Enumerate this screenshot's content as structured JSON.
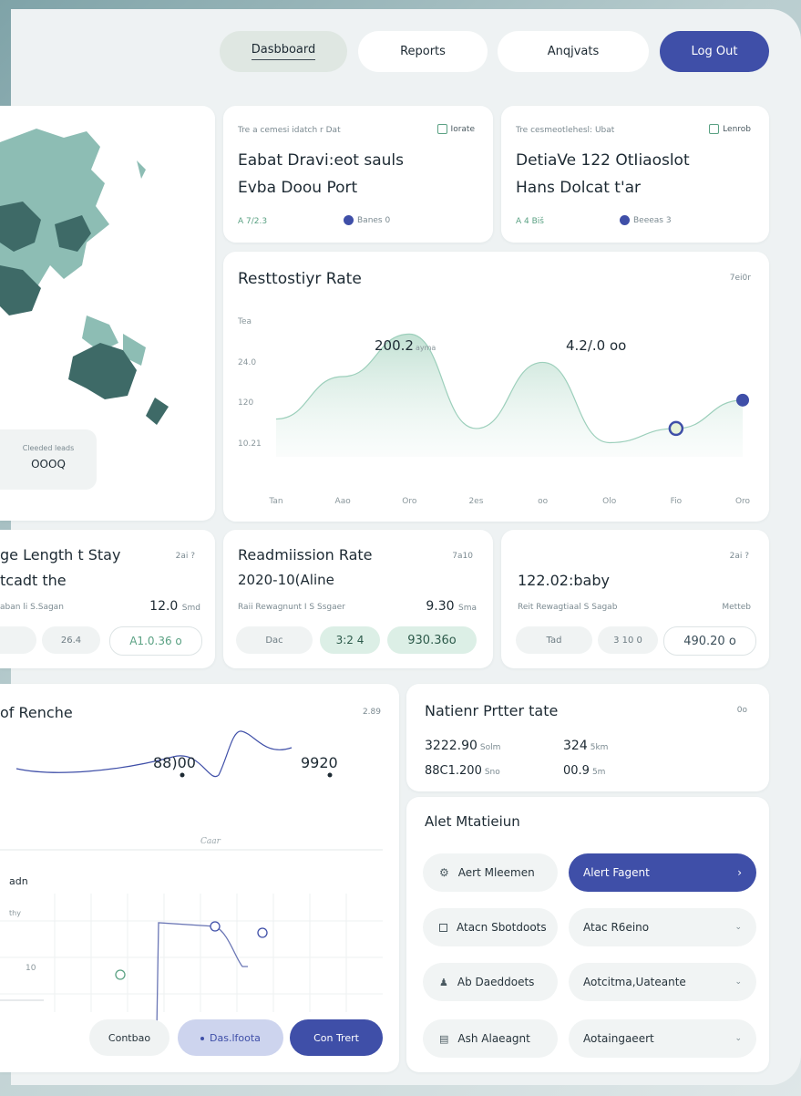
{
  "nav": {
    "dashboard": "Dasbboard",
    "reports": "Reports",
    "analytics": "Anqjvats",
    "logout": "Log Out"
  },
  "map": {
    "badge_label": "Cleeded leads",
    "badge_value": "OOOQ"
  },
  "info_cards": [
    {
      "meta": "Tre a cemesi idatch r Dat",
      "tag": "Iorate",
      "title_line1": "Eabat Dravi:eot sauls",
      "title_line2": "Evba  Doou Port",
      "foot_left": "A 7/2.3",
      "foot_right": "Banes 0"
    },
    {
      "meta": "Tre cesmeotlehesl: Ubat",
      "tag": "Lenrob",
      "title_line1": "DetiaVe 122 OtIiaoslot",
      "title_line2": "Hans Dolcat t'ar",
      "foot_left": "A 4 Biš",
      "foot_right": "Beeeas 3"
    }
  ],
  "main_chart": {
    "title": "Resttostiyr Rate",
    "corner": "7ei0r",
    "label_peak1": "200.2",
    "label_peak1_suffix": "ayma",
    "label_peak2": "4.2/.0 oo",
    "y_top": "Tea",
    "y_ticks": [
      "24.0",
      "120",
      "10.21"
    ],
    "x_ticks": [
      "Tan",
      "Aao",
      "Oro",
      "2es",
      "oo",
      "Olo",
      "Fio",
      "Oro"
    ]
  },
  "chart_data": {
    "type": "area",
    "x": [
      "Tan",
      "Aao",
      "Oro",
      "2es",
      "oo",
      "Olo",
      "Fio",
      "Oro"
    ],
    "series": [
      {
        "values": [
          8,
          17,
          26,
          6,
          20,
          3,
          6,
          12
        ]
      }
    ],
    "annotations": [
      "200.2",
      "4.2/.0 oo"
    ],
    "grid": false,
    "legend": "none"
  },
  "stat_cards": [
    {
      "title": "ge Length t Stay",
      "corner": "2ai ?",
      "subtitle": "tcadt the",
      "meta": "aban li S.Sagan",
      "meta_value": "12.0",
      "meta_unit": "Smd",
      "pill_1": "",
      "pill_2": "26.4",
      "pill_3": "A1.0.36 o"
    },
    {
      "title": "Readmiission Rate",
      "corner": "7a10",
      "subtitle": "2020-10(Aline",
      "meta": "Raii Rewagnunt I S Ssgaer",
      "meta_value": "9.30",
      "meta_unit": "Sma",
      "pill_1": "Dac",
      "pill_2": "3:2 4",
      "pill_3": "930.36o"
    },
    {
      "title": "",
      "corner": "2ai ?",
      "subtitle": "122.02:baby",
      "meta": "Reit Rewagtiaal S Sagab",
      "meta_value": "",
      "meta_unit": "Metteb",
      "pill_1": "Tad",
      "pill_2": "3 10 0",
      "pill_3": "490.20 o"
    }
  ],
  "rate_card": {
    "title": "of Renche",
    "corner": "2.89",
    "value_1": "88)00",
    "value_2": "9920",
    "footer": "Caar",
    "section_title": "adn",
    "y_tick_top": "thy",
    "y_tick": "10",
    "btn_1": "Contbao",
    "btn_2": "Das.lfoota",
    "btn_3": "Con Trert"
  },
  "patient_card": {
    "title": "Natienr Prtter tate",
    "corner": "0o",
    "r1_v1": "3222.90",
    "r1_u1": "Solm",
    "r1_v2": "324",
    "r1_u2": "5km",
    "r2_v1": "88C1.200",
    "r2_u1": "Sno",
    "r2_v2": "00.9",
    "r2_u2": "5m"
  },
  "alert_card": {
    "title": "Alet Mtatieiun",
    "rows": [
      {
        "left": "Aert Mleemen",
        "right": "Alert Fagent"
      },
      {
        "left": "Atacn Sbotdoots",
        "right": "Atac R6eino"
      },
      {
        "left": "Ab Daeddoets",
        "right": "Aotcitma,Uateante"
      },
      {
        "left": "Ash Alaeagnt",
        "right": "Aotaingaeert"
      }
    ]
  },
  "colors": {
    "accent": "#3f4fa8",
    "mint": "#cfe7dc",
    "map_dark": "#3e6a67",
    "map_light": "#8dbdb4"
  }
}
